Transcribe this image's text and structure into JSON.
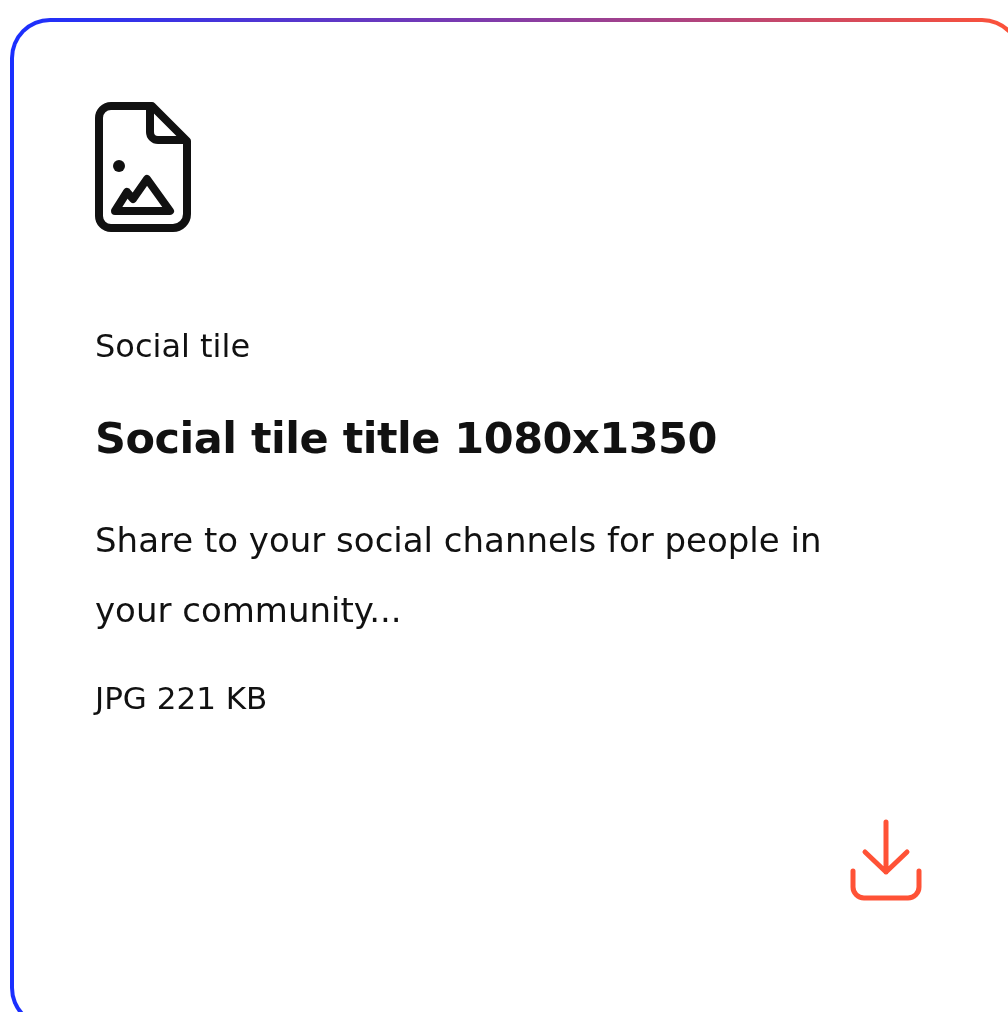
{
  "card": {
    "eyebrow": "Social tile",
    "title": "Social tile title 1080x1350",
    "description": "Share to your social channels for people in your community...",
    "file_info": "JPG 221 KB"
  }
}
